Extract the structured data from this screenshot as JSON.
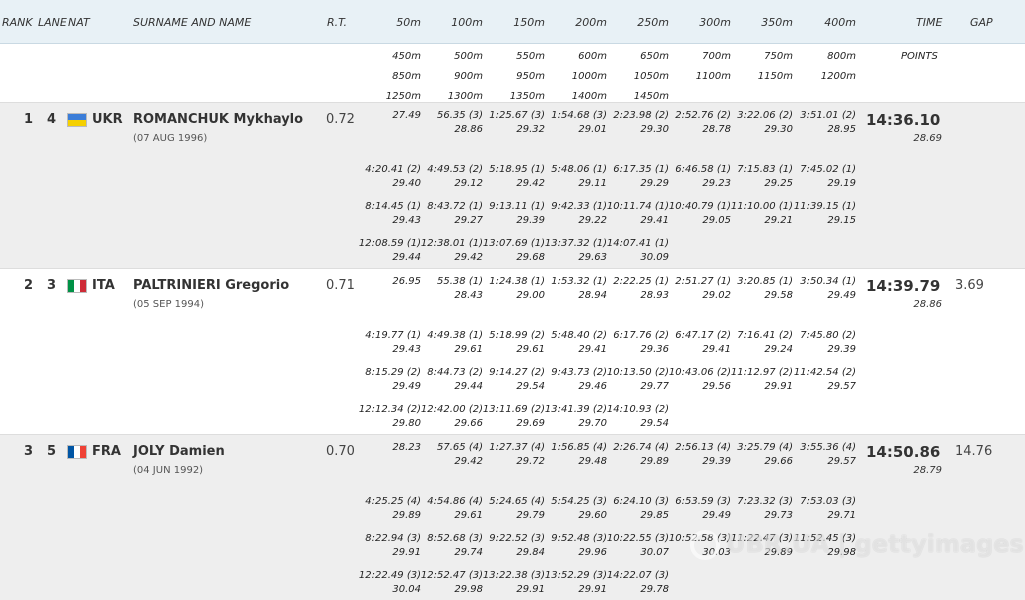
{
  "header": {
    "rank": "RANK",
    "lane": "LANE",
    "nat": "NAT",
    "name": "SURNAME AND NAME",
    "rt": "R.T.",
    "splits": [
      "50m",
      "100m",
      "150m",
      "200m",
      "250m",
      "300m",
      "350m",
      "400m"
    ],
    "time": "TIME",
    "gap": "GAP"
  },
  "subheader": {
    "row1": [
      "450m",
      "500m",
      "550m",
      "600m",
      "650m",
      "700m",
      "750m",
      "800m"
    ],
    "points": "POINTS",
    "row2": [
      "850m",
      "900m",
      "950m",
      "1000m",
      "1050m",
      "1100m",
      "1150m",
      "1200m"
    ],
    "row3": [
      "1250m",
      "1300m",
      "1350m",
      "1400m",
      "1450m"
    ]
  },
  "athletes": [
    {
      "rank": "1",
      "lane": "4",
      "nat": "UKR",
      "name": "ROMANCHUK Mykhaylo",
      "dob": "(07 AUG 1996)",
      "rt": "0.72",
      "time": "14:36.10",
      "points": "28.69",
      "gap": "",
      "flag": [
        "#3b7dd8",
        "#f5d000"
      ],
      "flag_dir": "h",
      "lines": [
        [
          [
            "27.49",
            ""
          ],
          [
            "56.35 (3)",
            "28.86"
          ],
          [
            "1:25.67 (3)",
            "29.32"
          ],
          [
            "1:54.68 (3)",
            "29.01"
          ],
          [
            "2:23.98 (2)",
            "29.30"
          ],
          [
            "2:52.76 (2)",
            "28.78"
          ],
          [
            "3:22.06 (2)",
            "29.30"
          ],
          [
            "3:51.01 (2)",
            "28.95"
          ]
        ],
        [
          [
            "4:20.41 (2)",
            "29.40"
          ],
          [
            "4:49.53 (2)",
            "29.12"
          ],
          [
            "5:18.95 (1)",
            "29.42"
          ],
          [
            "5:48.06 (1)",
            "29.11"
          ],
          [
            "6:17.35 (1)",
            "29.29"
          ],
          [
            "6:46.58 (1)",
            "29.23"
          ],
          [
            "7:15.83 (1)",
            "29.25"
          ],
          [
            "7:45.02 (1)",
            "29.19"
          ]
        ],
        [
          [
            "8:14.45 (1)",
            "29.43"
          ],
          [
            "8:43.72 (1)",
            "29.27"
          ],
          [
            "9:13.11 (1)",
            "29.39"
          ],
          [
            "9:42.33 (1)",
            "29.22"
          ],
          [
            "10:11.74 (1)",
            "29.41"
          ],
          [
            "10:40.79 (1)",
            "29.05"
          ],
          [
            "11:10.00 (1)",
            "29.21"
          ],
          [
            "11:39.15 (1)",
            "29.15"
          ]
        ],
        [
          [
            "12:08.59 (1)",
            "29.44"
          ],
          [
            "12:38.01 (1)",
            "29.42"
          ],
          [
            "13:07.69 (1)",
            "29.68"
          ],
          [
            "13:37.32 (1)",
            "29.63"
          ],
          [
            "14:07.41 (1)",
            "30.09"
          ]
        ]
      ]
    },
    {
      "rank": "2",
      "lane": "3",
      "nat": "ITA",
      "name": "PALTRINIERI Gregorio",
      "dob": "(05 SEP 1994)",
      "rt": "0.71",
      "time": "14:39.79",
      "points": "28.86",
      "gap": "3.69",
      "flag": [
        "#009246",
        "#ffffff",
        "#ce2b37"
      ],
      "flag_dir": "v",
      "lines": [
        [
          [
            "26.95",
            ""
          ],
          [
            "55.38 (1)",
            "28.43"
          ],
          [
            "1:24.38 (1)",
            "29.00"
          ],
          [
            "1:53.32 (1)",
            "28.94"
          ],
          [
            "2:22.25 (1)",
            "28.93"
          ],
          [
            "2:51.27 (1)",
            "29.02"
          ],
          [
            "3:20.85 (1)",
            "29.58"
          ],
          [
            "3:50.34 (1)",
            "29.49"
          ]
        ],
        [
          [
            "4:19.77 (1)",
            "29.43"
          ],
          [
            "4:49.38 (1)",
            "29.61"
          ],
          [
            "5:18.99 (2)",
            "29.61"
          ],
          [
            "5:48.40 (2)",
            "29.41"
          ],
          [
            "6:17.76 (2)",
            "29.36"
          ],
          [
            "6:47.17 (2)",
            "29.41"
          ],
          [
            "7:16.41 (2)",
            "29.24"
          ],
          [
            "7:45.80 (2)",
            "29.39"
          ]
        ],
        [
          [
            "8:15.29 (2)",
            "29.49"
          ],
          [
            "8:44.73 (2)",
            "29.44"
          ],
          [
            "9:14.27 (2)",
            "29.54"
          ],
          [
            "9:43.73 (2)",
            "29.46"
          ],
          [
            "10:13.50 (2)",
            "29.77"
          ],
          [
            "10:43.06 (2)",
            "29.56"
          ],
          [
            "11:12.97 (2)",
            "29.91"
          ],
          [
            "11:42.54 (2)",
            "29.57"
          ]
        ],
        [
          [
            "12:12.34 (2)",
            "29.80"
          ],
          [
            "12:42.00 (2)",
            "29.66"
          ],
          [
            "13:11.69 (2)",
            "29.69"
          ],
          [
            "13:41.39 (2)",
            "29.70"
          ],
          [
            "14:10.93 (2)",
            "29.54"
          ]
        ]
      ]
    },
    {
      "rank": "3",
      "lane": "5",
      "nat": "FRA",
      "name": "JOLY Damien",
      "dob": "(04 JUN 1992)",
      "rt": "0.70",
      "time": "14:50.86",
      "points": "28.79",
      "gap": "14.76",
      "flag": [
        "#0055a4",
        "#ffffff",
        "#ef4135"
      ],
      "flag_dir": "v",
      "lines": [
        [
          [
            "28.23",
            ""
          ],
          [
            "57.65 (4)",
            "29.42"
          ],
          [
            "1:27.37 (4)",
            "29.72"
          ],
          [
            "1:56.85 (4)",
            "29.48"
          ],
          [
            "2:26.74 (4)",
            "29.89"
          ],
          [
            "2:56.13 (4)",
            "29.39"
          ],
          [
            "3:25.79 (4)",
            "29.66"
          ],
          [
            "3:55.36 (4)",
            "29.57"
          ]
        ],
        [
          [
            "4:25.25 (4)",
            "29.89"
          ],
          [
            "4:54.86 (4)",
            "29.61"
          ],
          [
            "5:24.65 (4)",
            "29.79"
          ],
          [
            "5:54.25 (3)",
            "29.60"
          ],
          [
            "6:24.10 (3)",
            "29.85"
          ],
          [
            "6:53.59 (3)",
            "29.49"
          ],
          [
            "7:23.32 (3)",
            "29.73"
          ],
          [
            "7:53.03 (3)",
            "29.71"
          ]
        ],
        [
          [
            "8:22.94 (3)",
            "29.91"
          ],
          [
            "8:52.68 (3)",
            "29.74"
          ],
          [
            "9:22.52 (3)",
            "29.84"
          ],
          [
            "9:52.48 (3)",
            "29.96"
          ],
          [
            "10:22.55 (3)",
            "30.07"
          ],
          [
            "10:52.58 (3)",
            "30.03"
          ],
          [
            "11:22.47 (3)",
            "29.89"
          ],
          [
            "11:52.45 (3)",
            "29.98"
          ]
        ],
        [
          [
            "12:22.49 (3)",
            "30.04"
          ],
          [
            "12:52.47 (3)",
            "29.98"
          ],
          [
            "13:22.38 (3)",
            "29.91"
          ],
          [
            "13:52.29 (3)",
            "29.91"
          ],
          [
            "14:22.07 (3)",
            "29.78"
          ]
        ]
      ]
    }
  ],
  "watermark": "UBR.UA | gettyimages"
}
